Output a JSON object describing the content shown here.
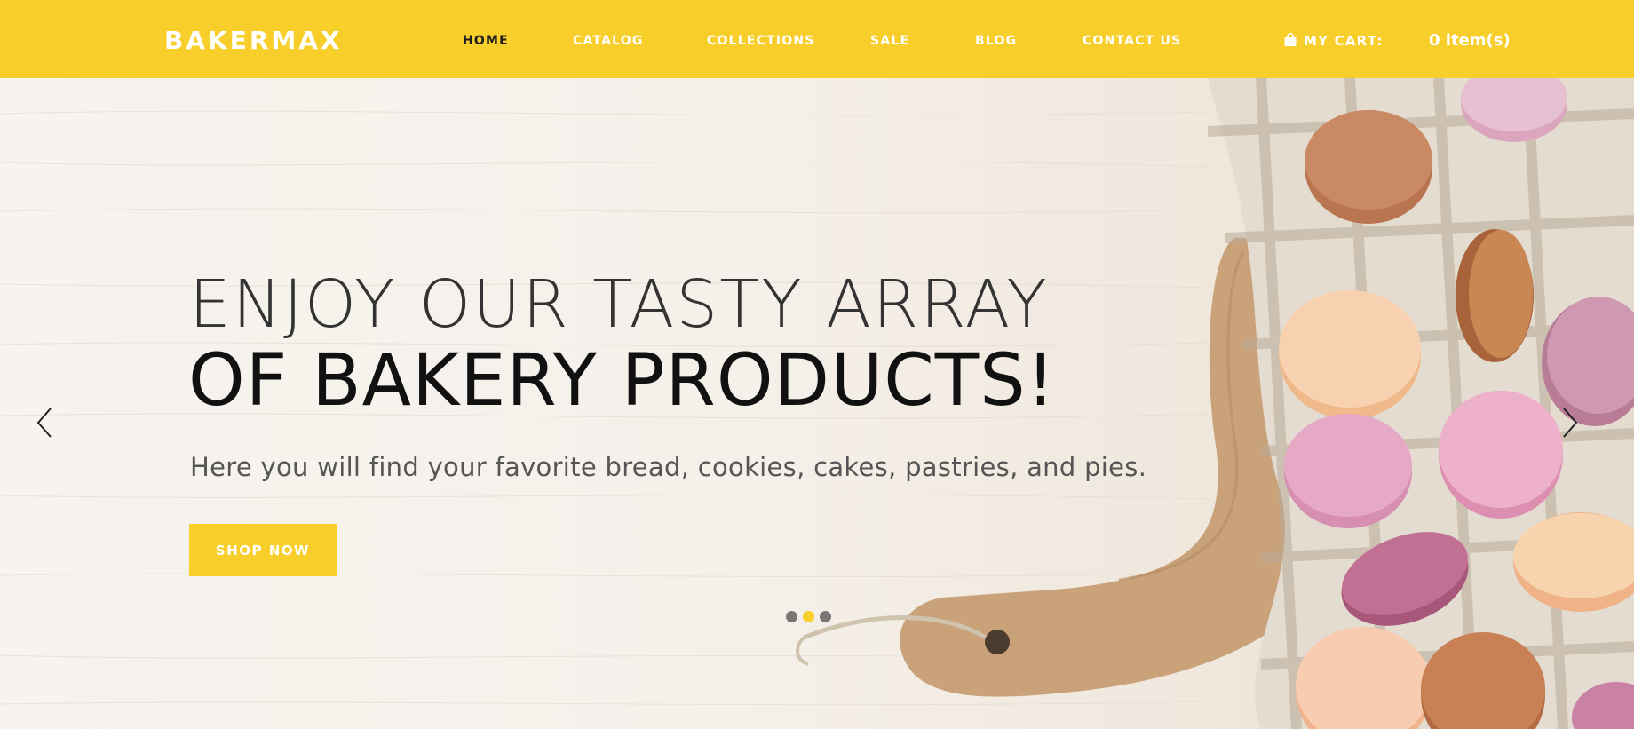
{
  "header": {
    "logo": "BAKERMAX",
    "nav": [
      {
        "label": "HOME",
        "active": true
      },
      {
        "label": "CATALOG",
        "active": false
      },
      {
        "label": "COLLECTIONS",
        "active": false
      },
      {
        "label": "SALE",
        "active": false
      },
      {
        "label": "BLOG",
        "active": false
      },
      {
        "label": "CONTACT US",
        "active": false
      }
    ],
    "cart": {
      "label": "MY CART:",
      "count": "0 item(s)",
      "icon": "shopping-bag-icon"
    }
  },
  "hero": {
    "headline_line1": "ENJOY OUR TASTY ARRAY",
    "headline_line2": "OF BAKERY PRODUCTS!",
    "subtext": "Here you will find your favorite bread, cookies, cakes, pastries, and pies.",
    "cta": "SHOP NOW",
    "prev_icon": "chevron-left-icon",
    "next_icon": "chevron-right-icon",
    "slides": 3,
    "active_slide": 2
  },
  "colors": {
    "accent": "#f7ce2a",
    "header_text": "#ffffff",
    "active_nav": "#1d1d1d"
  }
}
